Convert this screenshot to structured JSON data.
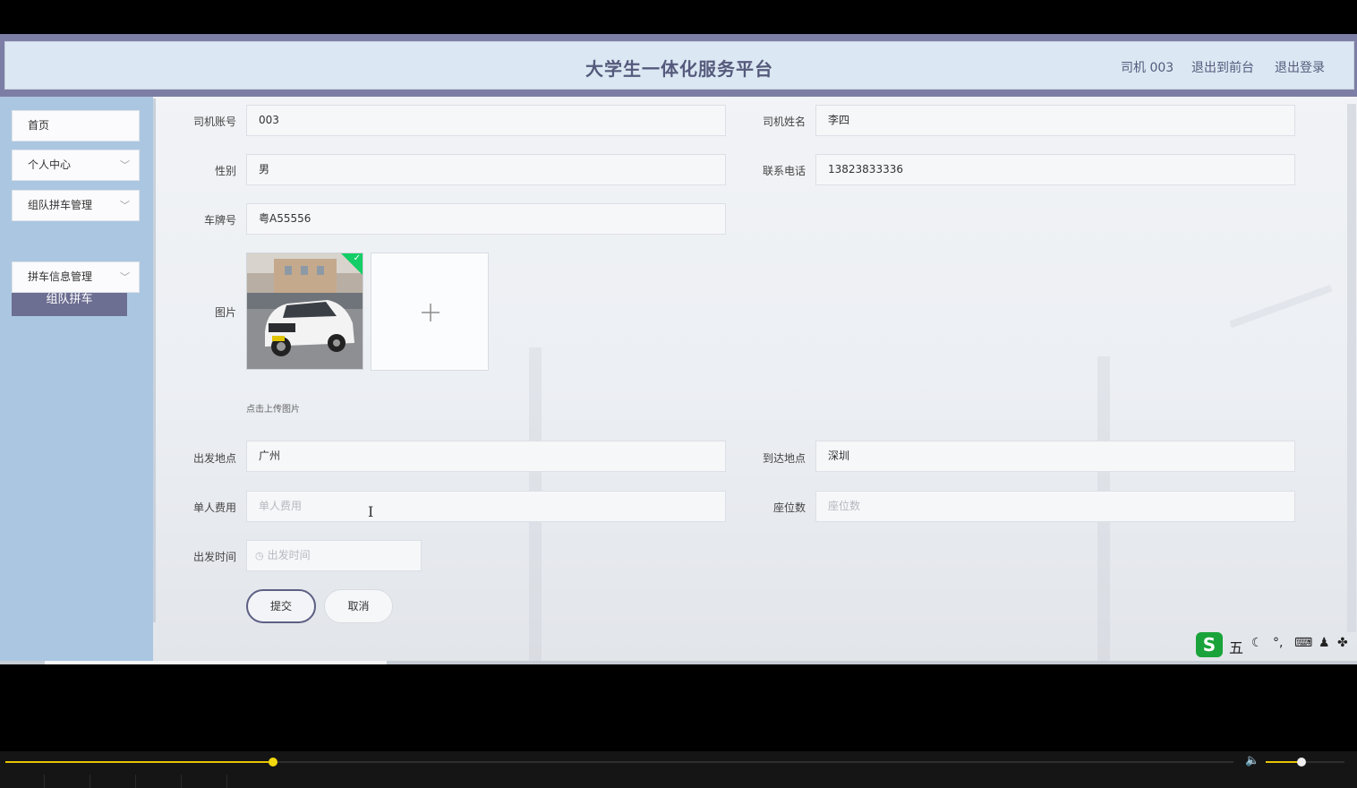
{
  "header": {
    "title": "大学生一体化服务平台",
    "user_link": "司机 003",
    "front_link": "退出到前台",
    "logout_link": "退出登录"
  },
  "sidebar": {
    "items": [
      {
        "label": "首页"
      },
      {
        "label": "个人中心"
      },
      {
        "label": "组队拼车管理"
      },
      {
        "label": "拼车信息管理"
      }
    ],
    "submenu_active": "组队拼车"
  },
  "form": {
    "driver_account": {
      "label": "司机账号",
      "value": "003"
    },
    "driver_name": {
      "label": "司机姓名",
      "value": "李四"
    },
    "gender": {
      "label": "性别",
      "value": "男"
    },
    "phone": {
      "label": "联系电话",
      "value": "13823833336"
    },
    "plate": {
      "label": "车牌号",
      "value": "粤A55556"
    },
    "image": {
      "label": "图片",
      "hint": "点击上传图片"
    },
    "departure": {
      "label": "出发地点",
      "value": "广州"
    },
    "destination": {
      "label": "到达地点",
      "value": "深圳"
    },
    "fee": {
      "label": "单人费用",
      "placeholder": "单人费用"
    },
    "seats": {
      "label": "座位数",
      "placeholder": "座位数"
    },
    "depart_time": {
      "label": "出发时间",
      "placeholder": "出发时间"
    },
    "submit_label": "提交",
    "cancel_label": "取消"
  },
  "ime": {
    "char": "五"
  },
  "player": {
    "progress": 0.218,
    "volume": 0.45
  },
  "colors": {
    "accent": "#6c6e92",
    "header_band": "#7d7ea5",
    "sidebar": "#abc6e0",
    "progress": "#e7c500"
  },
  "icons": [
    "clock-icon",
    "plus-icon",
    "check-icon",
    "chevron-down-icon",
    "volume-icon",
    "ime-logo-icon"
  ]
}
